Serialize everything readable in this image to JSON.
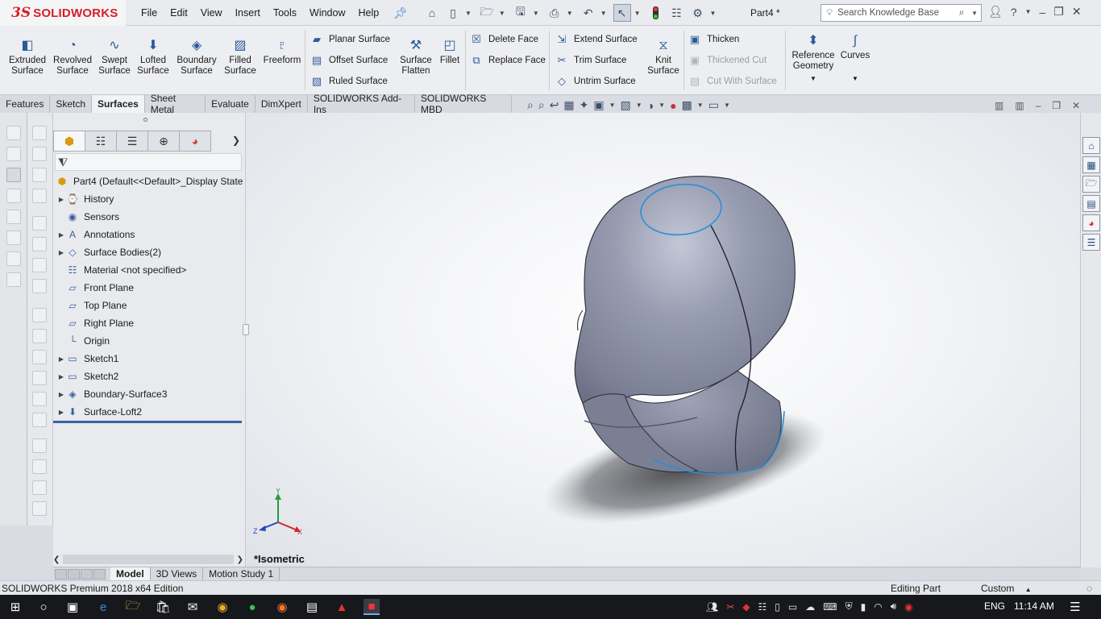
{
  "app": {
    "brand_ds": "3S",
    "brand_name": "SOLIDWORKS",
    "doc_title": "Part4 *"
  },
  "menu": [
    "File",
    "Edit",
    "View",
    "Insert",
    "Tools",
    "Window",
    "Help"
  ],
  "search": {
    "placeholder": "Search Knowledge Base"
  },
  "commands": {
    "extruded": [
      "Extruded",
      "Surface"
    ],
    "revolved": [
      "Revolved",
      "Surface"
    ],
    "swept": [
      "Swept",
      "Surface"
    ],
    "lofted": [
      "Lofted",
      "Surface"
    ],
    "boundary": [
      "Boundary",
      "Surface"
    ],
    "filled": [
      "Filled",
      "Surface"
    ],
    "freeform": "Freeform",
    "planar": "Planar Surface",
    "offset": "Offset Surface",
    "ruled": "Ruled Surface",
    "flatten": [
      "Surface",
      "Flatten"
    ],
    "fillet": "Fillet",
    "delete_face": "Delete Face",
    "replace_face": "Replace Face",
    "extend": "Extend Surface",
    "trim": "Trim Surface",
    "untrim": "Untrim Surface",
    "knit": [
      "Knit",
      "Surface"
    ],
    "thicken": "Thicken",
    "thickened_cut": "Thickened Cut",
    "cut_with_surface": "Cut With Surface",
    "reference_geometry": [
      "Reference",
      "Geometry"
    ],
    "curves": "Curves"
  },
  "tabs": [
    "Features",
    "Sketch",
    "Surfaces",
    "Sheet Metal",
    "Evaluate",
    "DimXpert",
    "SOLIDWORKS Add-Ins",
    "SOLIDWORKS MBD"
  ],
  "active_tab": "Surfaces",
  "tree": {
    "root": "Part4  (Default<<Default>_Display State",
    "items": [
      {
        "label": "History",
        "expandable": true,
        "icon": "history-icon"
      },
      {
        "label": "Sensors",
        "expandable": false,
        "icon": "sensor-icon"
      },
      {
        "label": "Annotations",
        "expandable": true,
        "icon": "annotation-icon"
      },
      {
        "label": "Surface Bodies(2)",
        "expandable": true,
        "icon": "surface-bodies-icon"
      },
      {
        "label": "Material <not specified>",
        "expandable": false,
        "icon": "material-icon"
      },
      {
        "label": "Front Plane",
        "expandable": false,
        "icon": "plane-icon"
      },
      {
        "label": "Top Plane",
        "expandable": false,
        "icon": "plane-icon"
      },
      {
        "label": "Right Plane",
        "expandable": false,
        "icon": "plane-icon"
      },
      {
        "label": "Origin",
        "expandable": false,
        "icon": "origin-icon"
      },
      {
        "label": "Sketch1",
        "expandable": true,
        "icon": "sketch-icon"
      },
      {
        "label": "Sketch2",
        "expandable": true,
        "icon": "sketch-icon"
      },
      {
        "label": "Boundary-Surface3",
        "expandable": true,
        "icon": "boundary-surface-icon"
      },
      {
        "label": "Surface-Loft2",
        "expandable": true,
        "icon": "loft-surface-icon"
      }
    ]
  },
  "viewport": {
    "view_name": "*Isometric",
    "axes": {
      "x": "X",
      "y": "Y",
      "z": "Z"
    }
  },
  "model_tabs": [
    "Model",
    "3D Views",
    "Motion Study 1"
  ],
  "status": {
    "left": "SOLIDWORKS Premium 2018 x64 Edition",
    "mode": "Editing Part",
    "units": "Custom"
  },
  "taskbar": {
    "lang": "ENG",
    "time": "11:14 AM"
  },
  "colors": {
    "brand_red": "#d62027",
    "model_gray": "#8e93a8",
    "edge_blue": "#2b8fd6",
    "rollback_bar": "#3a62a8"
  }
}
